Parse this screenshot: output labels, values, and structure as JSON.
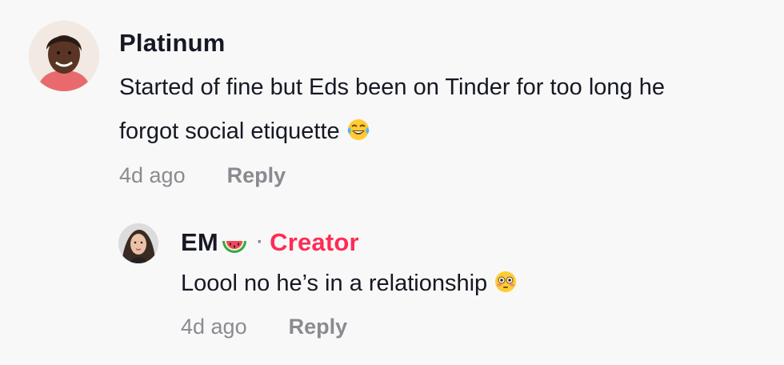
{
  "comments": [
    {
      "username": "Platinum",
      "text_line1": "Started of fine but Eds been on Tinder for too long he",
      "text_line2": "forgot social etiquette",
      "emoji": "tears-of-joy-emoji",
      "time": "4d ago",
      "reply_label": "Reply"
    }
  ],
  "reply": {
    "username": "EM",
    "username_emoji": "watermelon-emoji",
    "separator": "·",
    "badge": "Creator",
    "text": "Loool no he’s in a relationship",
    "emoji": "flushed-face-emoji",
    "time": "4d ago",
    "reply_label": "Reply"
  },
  "colors": {
    "background": "#f8f8f8",
    "text": "#161823",
    "muted": "#8a8b91",
    "creator": "#fe2c55"
  }
}
